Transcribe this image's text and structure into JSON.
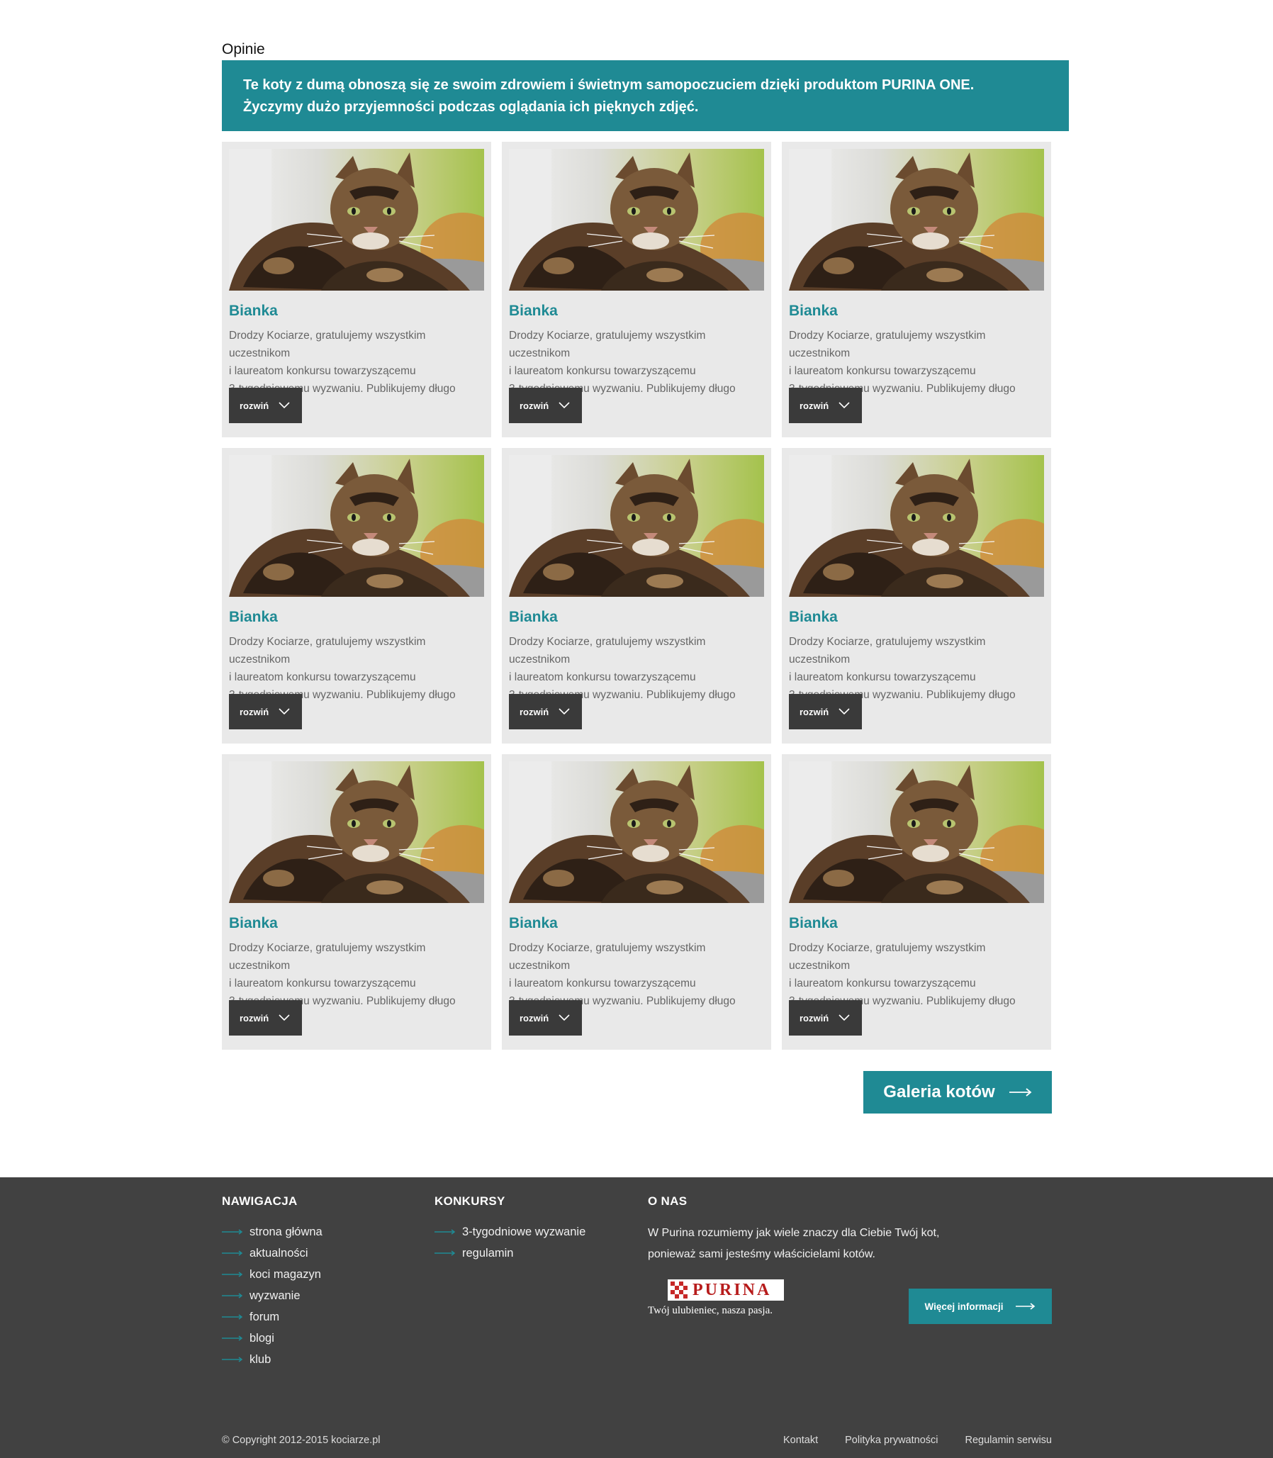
{
  "page": {
    "title": "Opinie"
  },
  "intro": {
    "line1": "Te koty z dumą obnoszą się ze swoim zdrowiem i świetnym samopoczuciem dzięki produktom PURINA ONE.",
    "line2": "Życzymy dużo przyjemności podczas oglądania ich pięknych zdjęć."
  },
  "cards": [
    {
      "name": "Bianka",
      "line1": "Drodzy Kociarze, gratulujemy wszystkim uczestnikom",
      "line2": "i laureatom konkursu towarzyszącemu",
      "line3": "3-tygodniowemu wyzwaniu. Publikujemy długo",
      "button": "rozwiń"
    },
    {
      "name": "Bianka",
      "line1": "Drodzy Kociarze, gratulujemy wszystkim uczestnikom",
      "line2": "i laureatom konkursu towarzyszącemu",
      "line3": "3-tygodniowemu wyzwaniu. Publikujemy długo",
      "button": "rozwiń"
    },
    {
      "name": "Bianka",
      "line1": "Drodzy Kociarze, gratulujemy wszystkim uczestnikom",
      "line2": "i laureatom konkursu towarzyszącemu",
      "line3": "3-tygodniowemu wyzwaniu. Publikujemy długo",
      "button": "rozwiń"
    },
    {
      "name": "Bianka",
      "line1": "Drodzy Kociarze, gratulujemy wszystkim uczestnikom",
      "line2": "i laureatom konkursu towarzyszącemu",
      "line3": "3-tygodniowemu wyzwaniu. Publikujemy długo",
      "button": "rozwiń"
    },
    {
      "name": "Bianka",
      "line1": "Drodzy Kociarze, gratulujemy wszystkim uczestnikom",
      "line2": "i laureatom konkursu towarzyszącemu",
      "line3": "3-tygodniowemu wyzwaniu. Publikujemy długo",
      "button": "rozwiń"
    },
    {
      "name": "Bianka",
      "line1": "Drodzy Kociarze, gratulujemy wszystkim uczestnikom",
      "line2": "i laureatom konkursu towarzyszącemu",
      "line3": "3-tygodniowemu wyzwaniu. Publikujemy długo",
      "button": "rozwiń"
    },
    {
      "name": "Bianka",
      "line1": "Drodzy Kociarze, gratulujemy wszystkim uczestnikom",
      "line2": "i laureatom konkursu towarzyszącemu",
      "line3": "3-tygodniowemu wyzwaniu. Publikujemy długo",
      "button": "rozwiń"
    },
    {
      "name": "Bianka",
      "line1": "Drodzy Kociarze, gratulujemy wszystkim uczestnikom",
      "line2": "i laureatom konkursu towarzyszącemu",
      "line3": "3-tygodniowemu wyzwaniu. Publikujemy długo",
      "button": "rozwiń"
    },
    {
      "name": "Bianka",
      "line1": "Drodzy Kociarze, gratulujemy wszystkim uczestnikom",
      "line2": "i laureatom konkursu towarzyszącemu",
      "line3": "3-tygodniowemu wyzwaniu. Publikujemy długo",
      "button": "rozwiń"
    }
  ],
  "gallery_button": "Galeria kotów",
  "footer": {
    "nav": {
      "heading": "NAWIGACJA",
      "items": [
        "strona główna",
        "aktualności",
        "koci magazyn",
        "wyzwanie",
        "forum",
        "blogi",
        "klub"
      ]
    },
    "contests": {
      "heading": "KONKURSY",
      "items": [
        "3-tygodniowe wyzwanie",
        "regulamin"
      ]
    },
    "about": {
      "heading": "O NAS",
      "line1": "W Purina rozumiemy jak wiele znaczy dla Ciebie Twój kot,",
      "line2": "ponieważ sami jesteśmy właścicielami kotów.",
      "logo_word": "PURINA",
      "logo_tagline": "Twój ulubieniec, nasza pasja.",
      "more_button": "Więcej informacji"
    },
    "copyright": "© Copyright 2012-2015 kociarze.pl",
    "links": [
      "Kontakt",
      "Polityka prywatności",
      "Regulamin serwisu"
    ]
  },
  "colors": {
    "accent": "#1f8a94",
    "dark": "#414141",
    "card_bg": "#e9e9e9",
    "button_dark": "#3a3a3a",
    "logo_red": "#b71c1c"
  },
  "icons": {
    "expand": "chevron-down-icon",
    "arrow": "arrow-right-icon",
    "footer_bullet": "line-arrow-icon",
    "photo": "cat-photo"
  }
}
